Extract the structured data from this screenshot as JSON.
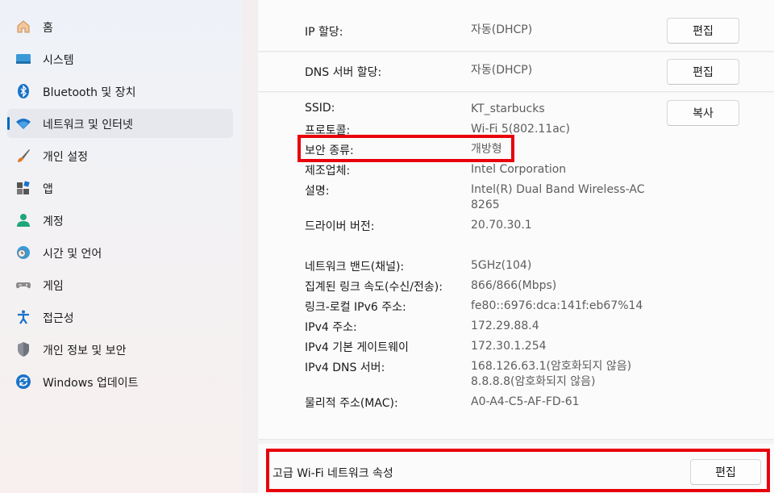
{
  "sidebar": {
    "items": [
      {
        "label": "홈",
        "icon": "home-icon"
      },
      {
        "label": "시스템",
        "icon": "system-icon"
      },
      {
        "label": "Bluetooth 및 장치",
        "icon": "bluetooth-icon"
      },
      {
        "label": "네트워크 및 인터넷",
        "icon": "wifi-icon",
        "active": true
      },
      {
        "label": "개인 설정",
        "icon": "brush-icon"
      },
      {
        "label": "앱",
        "icon": "apps-icon"
      },
      {
        "label": "계정",
        "icon": "account-icon"
      },
      {
        "label": "시간 및 언어",
        "icon": "time-language-icon"
      },
      {
        "label": "게임",
        "icon": "gamepad-icon"
      },
      {
        "label": "접근성",
        "icon": "accessibility-icon"
      },
      {
        "label": "개인 정보 및 보안",
        "icon": "shield-icon"
      },
      {
        "label": "Windows 업데이트",
        "icon": "update-icon"
      }
    ]
  },
  "ip_assign": {
    "label": "IP 할당:",
    "value": "자동(DHCP)",
    "button": "편집"
  },
  "dns_assign": {
    "label": "DNS 서버 할당:",
    "value": "자동(DHCP)",
    "button": "편집"
  },
  "properties": {
    "copy_button": "복사",
    "ssid": {
      "label": "SSID:",
      "value": "KT_starbucks"
    },
    "protocol": {
      "label": "프로토콜:",
      "value": "Wi-Fi 5(802.11ac)"
    },
    "security": {
      "label": "보안 종류:",
      "value": "개방형"
    },
    "manufacturer": {
      "label": "제조업체:",
      "value": "Intel Corporation"
    },
    "description": {
      "label": "설명:",
      "value1": "Intel(R) Dual Band Wireless-AC",
      "value2": "8265"
    },
    "driver": {
      "label": "드라이버 버전:",
      "value": "20.70.30.1"
    },
    "band": {
      "label": "네트워크 밴드(채널):",
      "value": "5GHz(104)"
    },
    "speed": {
      "label": "집계된 링크 속도(수신/전송):",
      "value": "866/866(Mbps)"
    },
    "ipv6": {
      "label": "링크-로컬 IPv6 주소:",
      "value": "fe80::6976:dca:141f:eb67%14"
    },
    "ipv4": {
      "label": "IPv4 주소:",
      "value": "172.29.88.4"
    },
    "gateway": {
      "label": "IPv4 기본 게이트웨이",
      "value": "172.30.1.254"
    },
    "dns": {
      "label": "IPv4 DNS 서버:",
      "value1": "168.126.63.1(암호화되지 않음)",
      "value2": "8.8.8.8(암호화되지 않음)"
    },
    "mac": {
      "label": "물리적 주소(MAC):",
      "value": "A0-A4-C5-AF-FD-61"
    }
  },
  "advanced": {
    "label": "고급 Wi-Fi 네트워크 속성",
    "button": "편집"
  },
  "colors": {
    "accent": "#0067c0",
    "highlight": "#e8000b"
  }
}
